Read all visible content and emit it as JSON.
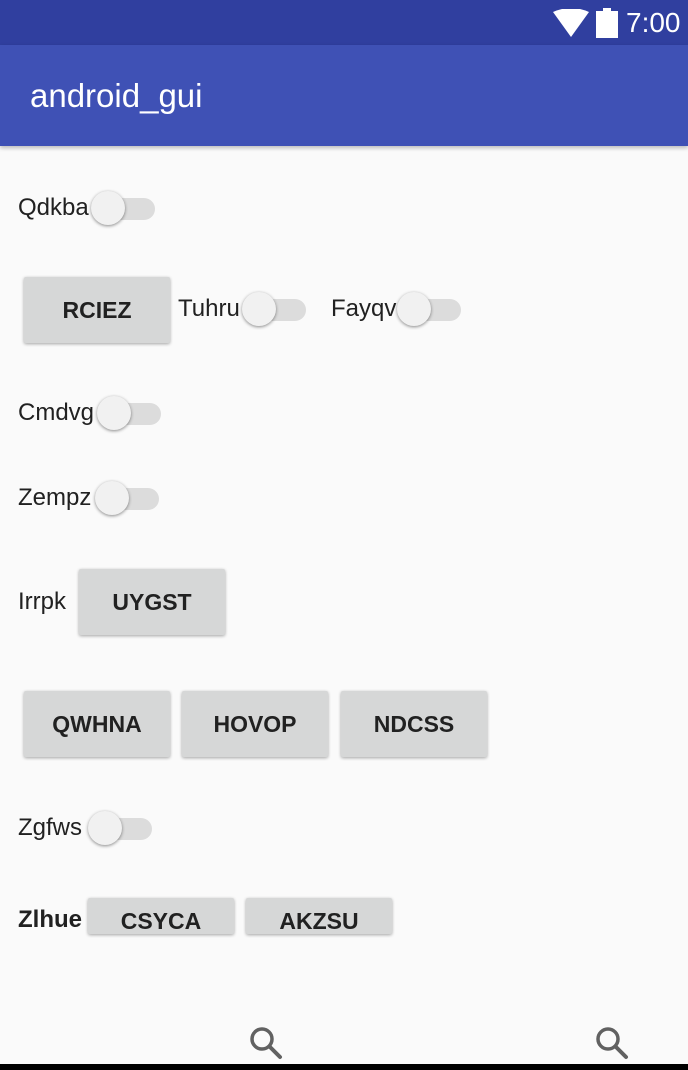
{
  "status_bar": {
    "time": "7:00",
    "icons": [
      "wifi-icon",
      "battery-icon"
    ]
  },
  "app_bar": {
    "title": "android_gui"
  },
  "rows": {
    "r1": {
      "switch_label": "Qdkba"
    },
    "r2": {
      "button_label": "RCIEZ",
      "switch1_label": "Tuhru",
      "switch2_label": "Fayqv"
    },
    "r3": {
      "switch_label": "Cmdvg"
    },
    "r4": {
      "switch_label": "Zempz"
    },
    "r5": {
      "label": "Irrpk",
      "button_label": "UYGST"
    },
    "r6": {
      "buttons": [
        "QWHNA",
        "HOVOP",
        "NDCSS"
      ]
    },
    "r7": {
      "switch_label": "Zgfws"
    },
    "r8": {
      "label": "Zlhue",
      "buttons": [
        "CSYCA",
        "AKZSU"
      ]
    }
  },
  "switch_states": {
    "Qdkba": false,
    "Tuhru": false,
    "Fayqv": false,
    "Cmdvg": false,
    "Zempz": false,
    "Zgfws": false
  },
  "bottom_bar": {
    "icons": [
      "search-icon",
      "search-icon"
    ]
  },
  "colors": {
    "status_bar": "#303f9f",
    "app_bar": "#3f51b5",
    "background": "#fafafa",
    "button": "#d6d7d7",
    "switch_track_off": "#dcdcdc",
    "switch_thumb_off": "#f1f1f1"
  }
}
